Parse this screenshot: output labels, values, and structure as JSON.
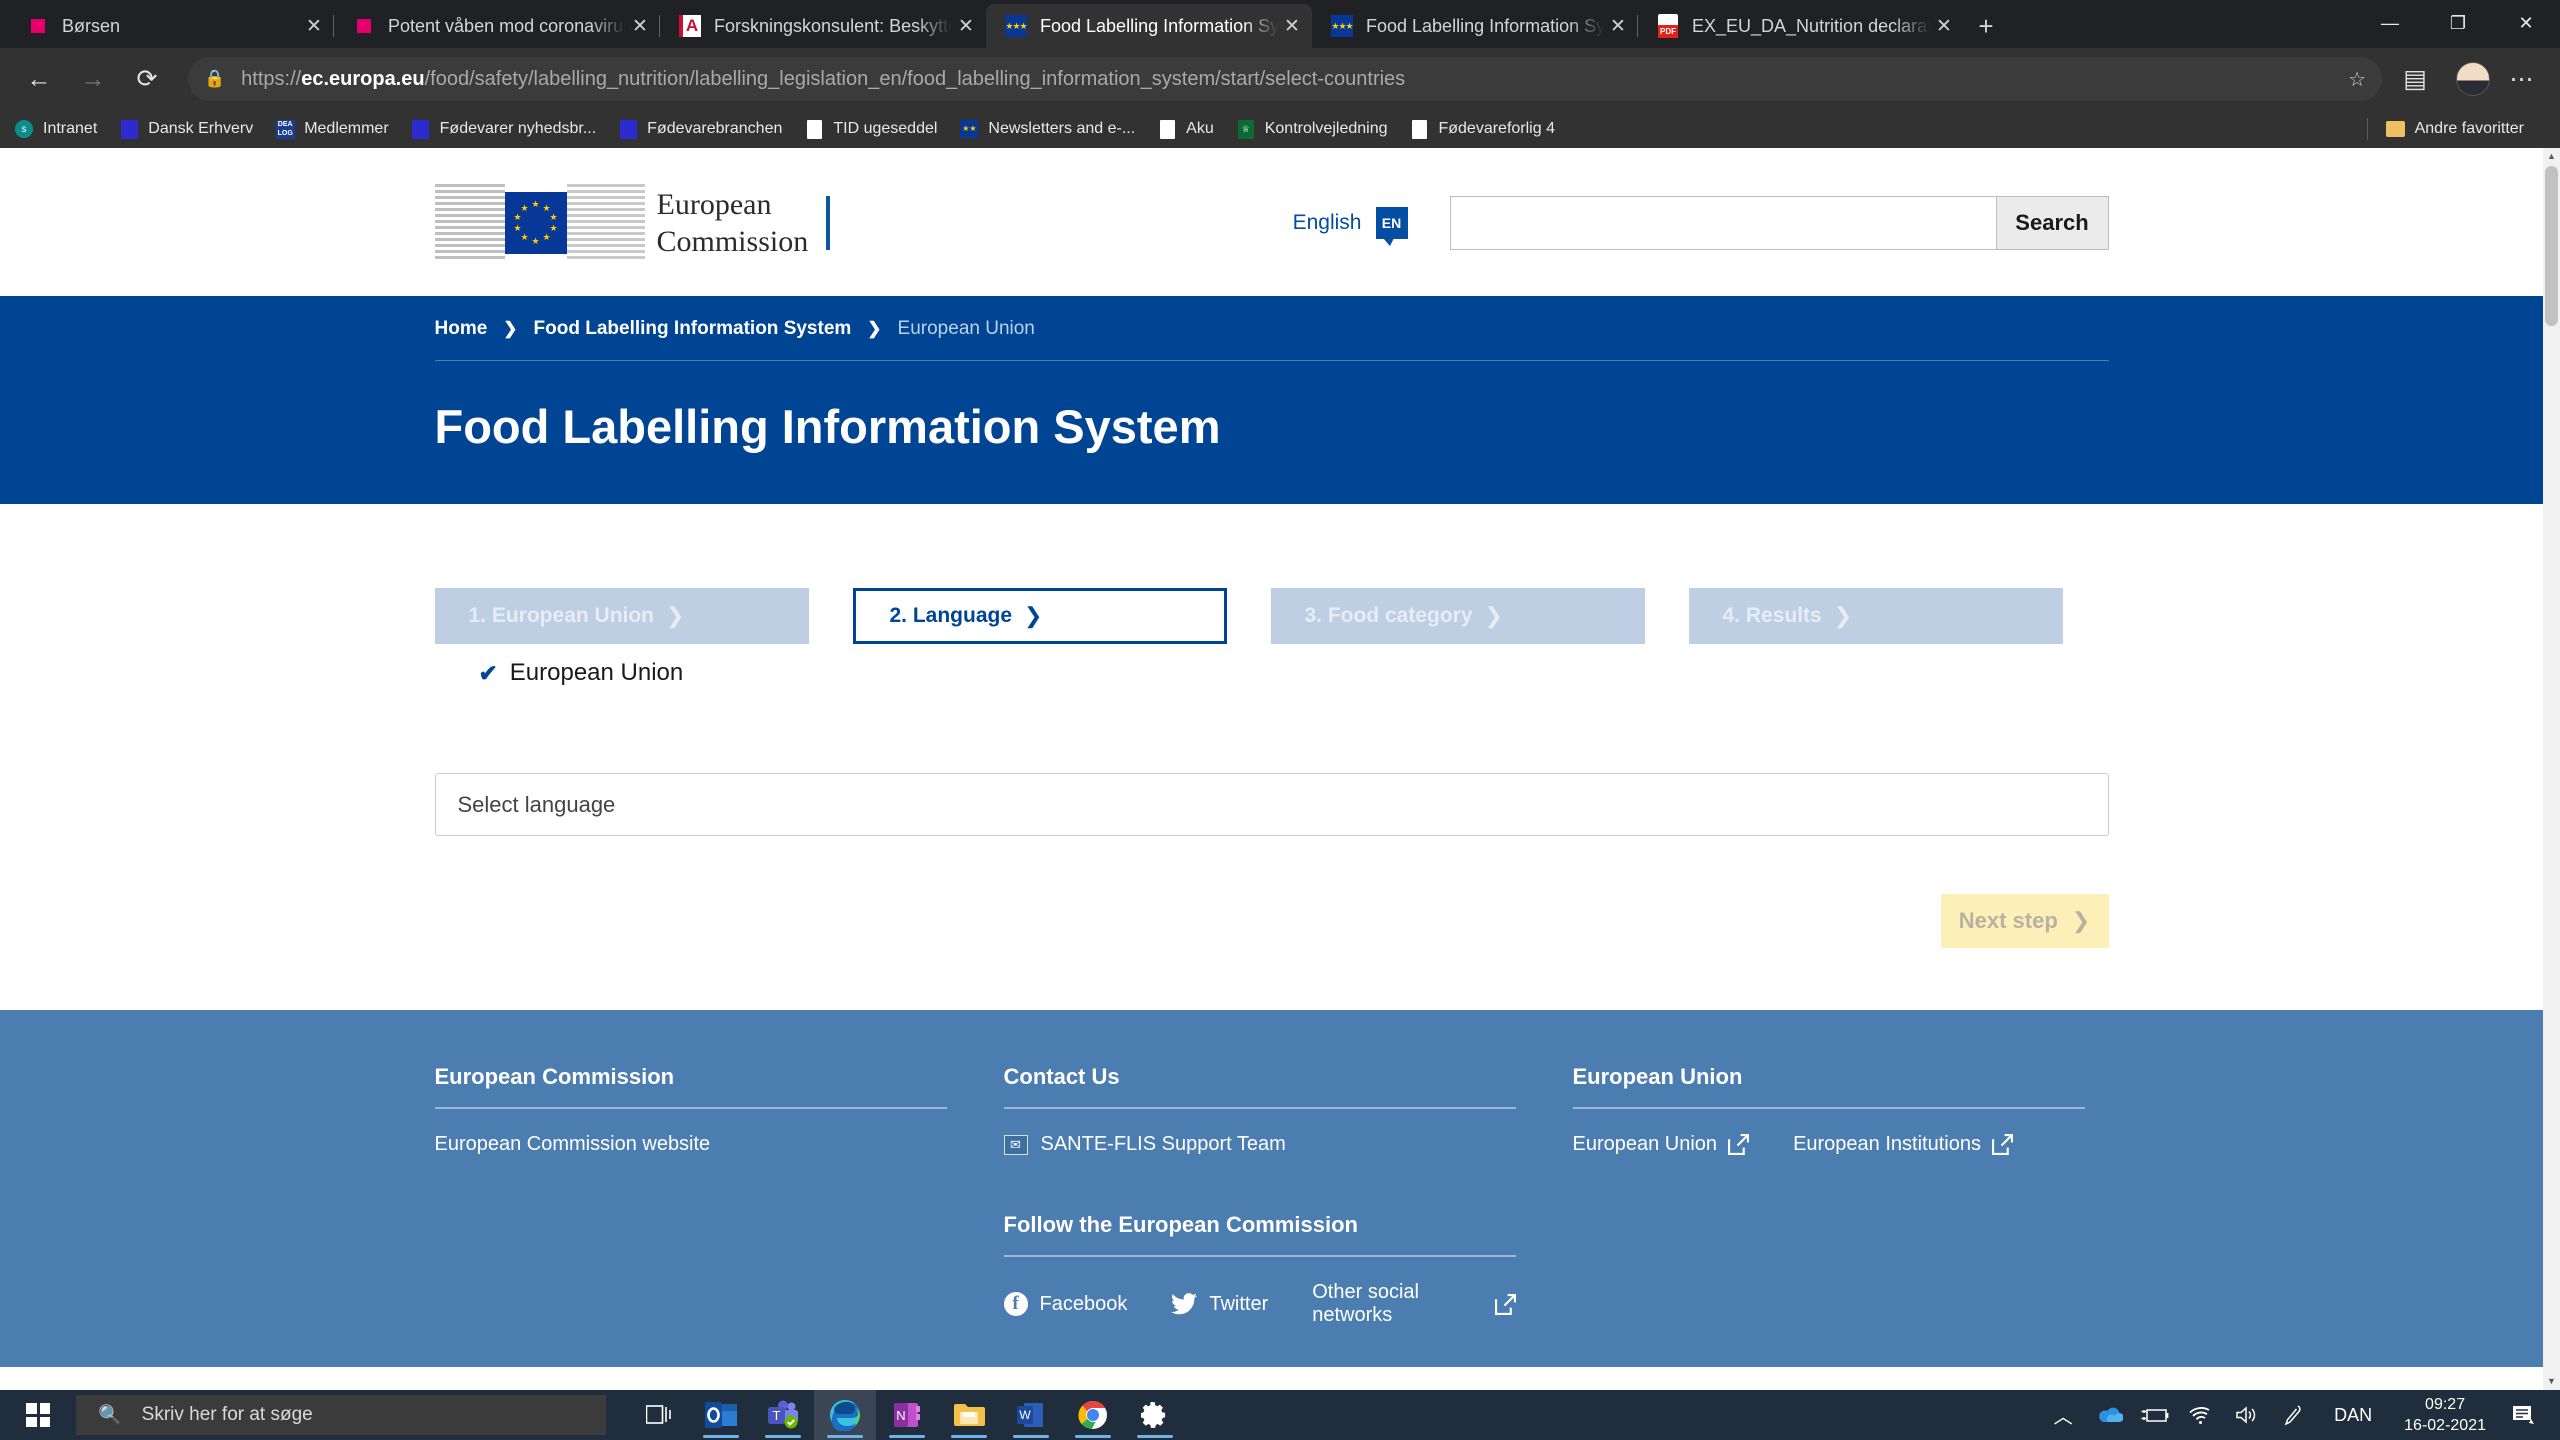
{
  "browser": {
    "tabs": [
      {
        "title": "Børsen",
        "favicon": "pink-square-icon",
        "active": false
      },
      {
        "title": "Potent våben mod coronavirus m",
        "favicon": "pink-square-icon",
        "active": false
      },
      {
        "title": "Forskningskonsulent: Beskyttelse",
        "favicon": "avisen-a-icon",
        "active": false
      },
      {
        "title": "Food Labelling Information Syste",
        "favicon": "eu-flag-icon",
        "active": true
      },
      {
        "title": "Food Labelling Information Syste",
        "favicon": "eu-flag-icon",
        "active": false
      },
      {
        "title": "EX_EU_DA_Nutrition declaration_",
        "favicon": "pdf-icon",
        "active": false
      }
    ],
    "new_tab_label": "+",
    "window_controls": {
      "minimize": "—",
      "maximize": "❐",
      "close": "✕"
    },
    "nav": {
      "back": "←",
      "forward": "→",
      "reload": "⟳"
    },
    "address": {
      "lock_icon": "lock-icon",
      "url_scheme": "https://",
      "url_domain": "ec.europa.eu",
      "url_path": "/food/safety/labelling_nutrition/labelling_legislation_en/food_labelling_information_system/start/select-countries",
      "favorite_icon": "star-add-icon",
      "collections_icon": "collections-add-icon",
      "settings_icon": "more-options-icon"
    },
    "bookmarks": [
      {
        "label": "Intranet",
        "icon": "sharepoint-icon"
      },
      {
        "label": "Dansk Erhverv",
        "icon": "blue-square-icon"
      },
      {
        "label": "Medlemmer",
        "icon": "dealog-icon"
      },
      {
        "label": "Fødevarer nyhedsbr...",
        "icon": "blue-square-icon"
      },
      {
        "label": "Fødevarebranchen",
        "icon": "blue-square-icon"
      },
      {
        "label": "TID ugeseddel",
        "icon": "document-icon"
      },
      {
        "label": "Newsletters and e-...",
        "icon": "eu-flag-icon"
      },
      {
        "label": "Aku",
        "icon": "document-icon"
      },
      {
        "label": "Kontrolvejledning",
        "icon": "crown-icon"
      },
      {
        "label": "Fødevareforlig 4",
        "icon": "document-icon"
      }
    ],
    "other_favorites": {
      "label": "Andre favoritter",
      "icon": "folder-icon"
    }
  },
  "site_header": {
    "logo_line1": "European",
    "logo_line2": "Commission",
    "language_label": "English",
    "language_code": "EN",
    "search_placeholder": "",
    "search_value": "",
    "search_button": "Search"
  },
  "breadcrumb": {
    "items": [
      {
        "label": "Home",
        "current": false
      },
      {
        "label": "Food Labelling Information System",
        "current": false
      },
      {
        "label": "European Union",
        "current": true
      }
    ],
    "separator": "❯"
  },
  "page": {
    "title": "Food Labelling Information System"
  },
  "wizard": {
    "chevron": "❯",
    "steps": [
      {
        "label": "1. European Union",
        "state": "completed"
      },
      {
        "label": "2. Language",
        "state": "active"
      },
      {
        "label": "3. Food category",
        "state": "disabled"
      },
      {
        "label": "4. Results",
        "state": "disabled"
      }
    ],
    "selection": {
      "tick": "✔",
      "label": "European Union"
    }
  },
  "form": {
    "language_select_placeholder": "Select language",
    "language_select_value": "",
    "next_button": "Next step",
    "next_button_chevron": "❯",
    "next_button_enabled": false
  },
  "footer": {
    "col1": {
      "heading": "European Commission",
      "links": [
        {
          "label": "European Commission website",
          "external": false
        }
      ]
    },
    "col2": {
      "heading": "Contact Us",
      "links": [
        {
          "label": "SANTE-FLIS Support Team",
          "icon": "mail-icon"
        }
      ],
      "sub_heading": "Follow the European Commission",
      "social": [
        {
          "label": "Facebook",
          "icon": "facebook-icon",
          "external": false
        },
        {
          "label": "Twitter",
          "icon": "twitter-icon",
          "external": false
        },
        {
          "label": "Other social networks",
          "icon": "",
          "external": true
        }
      ]
    },
    "col3": {
      "heading": "European Union",
      "links": [
        {
          "label": "European Union",
          "external": true
        },
        {
          "label": "European Institutions",
          "external": true
        }
      ]
    }
  },
  "taskbar": {
    "start_icon": "windows-logo-icon",
    "search_placeholder": "Skriv her at søge",
    "search_text": "Skriv her for at søge",
    "search_icon": "search-icon",
    "apps": [
      {
        "name": "task-view-icon",
        "running": false
      },
      {
        "name": "outlook-icon",
        "running": true
      },
      {
        "name": "teams-icon",
        "running": true
      },
      {
        "name": "edge-icon",
        "running": true,
        "focused": true
      },
      {
        "name": "onenote-icon",
        "running": true
      },
      {
        "name": "file-explorer-icon",
        "running": true
      },
      {
        "name": "word-icon",
        "running": true
      },
      {
        "name": "chrome-icon",
        "running": true
      },
      {
        "name": "settings-icon",
        "running": true
      }
    ],
    "tray": {
      "show_hidden": "︿",
      "onedrive": "onedrive-icon",
      "battery": "battery-charging-icon",
      "network": "wifi-icon",
      "volume": "volume-icon",
      "pen": "pen-icon",
      "language": "DAN",
      "time": "09:27",
      "date": "16-02-2021",
      "action_center": "notifications-icon"
    }
  },
  "colors": {
    "eu_blue": "#004494",
    "footer_blue": "#4c7db0",
    "step_disabled": "#bfcfe3",
    "next_button": "#fcf0b8",
    "browser_chrome": "#323232",
    "taskbar": "#1f2d3d"
  }
}
